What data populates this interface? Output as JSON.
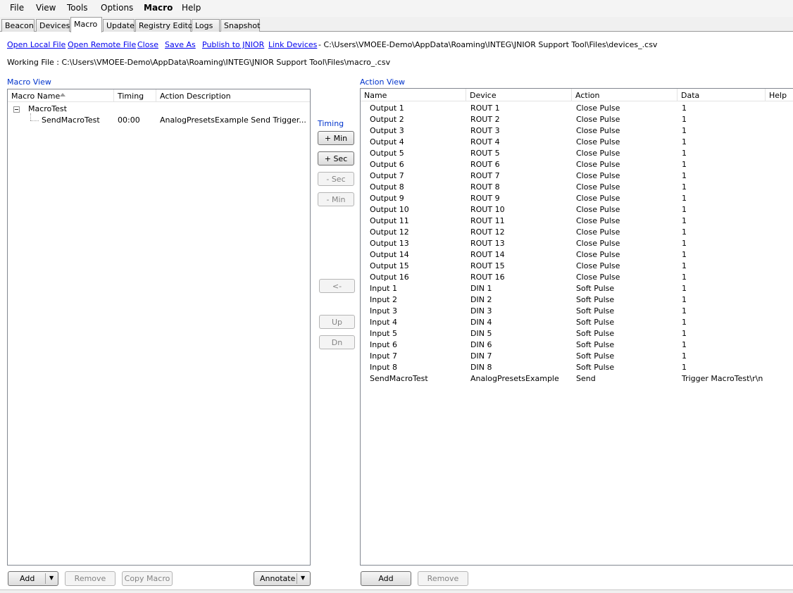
{
  "menu": {
    "file": "File",
    "view": "View",
    "tools": "Tools",
    "options": "Options",
    "macro": "Macro",
    "help": "Help"
  },
  "tabs": {
    "beacon": "Beacon",
    "devices": "Devices",
    "macro": "Macro",
    "update": "Update",
    "registry_editor": "Registry Editor",
    "logs": "Logs",
    "snapshot": "Snapshot"
  },
  "file_links": {
    "open_local": "Open Local File",
    "open_remote": "Open Remote File",
    "close": "Close",
    "save_as": "Save As",
    "publish": "Publish to JNIOR",
    "link_devices": "Link Devices"
  },
  "devices_path": "- C:\\Users\\VMOEE-Demo\\AppData\\Roaming\\INTEG\\JNIOR Support Tool\\Files\\devices_.csv",
  "working_file": "Working File : C:\\Users\\VMOEE-Demo\\AppData\\Roaming\\INTEG\\JNIOR Support Tool\\Files\\macro_.csv",
  "macro_view": {
    "title": "Macro View",
    "columns": {
      "name": "Macro Name",
      "timing": "Timing",
      "description": "Action Description"
    },
    "tree": {
      "macro": "MacroTest",
      "child": {
        "name": "SendMacroTest",
        "timing": "00:00",
        "description": "AnalogPresetsExample Send Trigger..."
      }
    }
  },
  "timing_controls": {
    "label": "Timing",
    "plus_min": "+ Min",
    "plus_sec": "+ Sec",
    "minus_sec": "- Sec",
    "minus_min": "- Min",
    "move_left": "<-",
    "up": "Up",
    "down": "Dn"
  },
  "action_view": {
    "title": "Action View",
    "columns": {
      "name": "Name",
      "device": "Device",
      "action": "Action",
      "data": "Data",
      "help": "Help"
    },
    "rows": [
      {
        "name": "Output 1",
        "device": "ROUT 1",
        "action": "Close Pulse",
        "data": "1"
      },
      {
        "name": "Output 2",
        "device": "ROUT 2",
        "action": "Close Pulse",
        "data": "1"
      },
      {
        "name": "Output 3",
        "device": "ROUT 3",
        "action": "Close Pulse",
        "data": "1"
      },
      {
        "name": "Output 4",
        "device": "ROUT 4",
        "action": "Close Pulse",
        "data": "1"
      },
      {
        "name": "Output 5",
        "device": "ROUT 5",
        "action": "Close Pulse",
        "data": "1"
      },
      {
        "name": "Output 6",
        "device": "ROUT 6",
        "action": "Close Pulse",
        "data": "1"
      },
      {
        "name": "Output 7",
        "device": "ROUT 7",
        "action": "Close Pulse",
        "data": "1"
      },
      {
        "name": "Output 8",
        "device": "ROUT 8",
        "action": "Close Pulse",
        "data": "1"
      },
      {
        "name": "Output 9",
        "device": "ROUT 9",
        "action": "Close Pulse",
        "data": "1"
      },
      {
        "name": "Output 10",
        "device": "ROUT 10",
        "action": "Close Pulse",
        "data": "1"
      },
      {
        "name": "Output 11",
        "device": "ROUT 11",
        "action": "Close Pulse",
        "data": "1"
      },
      {
        "name": "Output 12",
        "device": "ROUT 12",
        "action": "Close Pulse",
        "data": "1"
      },
      {
        "name": "Output 13",
        "device": "ROUT 13",
        "action": "Close Pulse",
        "data": "1"
      },
      {
        "name": "Output 14",
        "device": "ROUT 14",
        "action": "Close Pulse",
        "data": "1"
      },
      {
        "name": "Output 15",
        "device": "ROUT 15",
        "action": "Close Pulse",
        "data": "1"
      },
      {
        "name": "Output 16",
        "device": "ROUT 16",
        "action": "Close Pulse",
        "data": "1"
      },
      {
        "name": "Input 1",
        "device": "DIN 1",
        "action": "Soft Pulse",
        "data": "1"
      },
      {
        "name": "Input 2",
        "device": "DIN 2",
        "action": "Soft Pulse",
        "data": "1"
      },
      {
        "name": "Input 3",
        "device": "DIN 3",
        "action": "Soft Pulse",
        "data": "1"
      },
      {
        "name": "Input 4",
        "device": "DIN 4",
        "action": "Soft Pulse",
        "data": "1"
      },
      {
        "name": "Input 5",
        "device": "DIN 5",
        "action": "Soft Pulse",
        "data": "1"
      },
      {
        "name": "Input 6",
        "device": "DIN 6",
        "action": "Soft Pulse",
        "data": "1"
      },
      {
        "name": "Input 7",
        "device": "DIN 7",
        "action": "Soft Pulse",
        "data": "1"
      },
      {
        "name": "Input 8",
        "device": "DIN 8",
        "action": "Soft Pulse",
        "data": "1"
      },
      {
        "name": "SendMacroTest",
        "device": "AnalogPresetsExample",
        "action": "Send",
        "data": "Trigger MacroTest\\r\\n"
      }
    ]
  },
  "macro_buttons": {
    "add": "Add",
    "remove": "Remove",
    "copy_macro": "Copy Macro",
    "annotate": "Annotate"
  },
  "action_buttons": {
    "add": "Add",
    "remove": "Remove"
  },
  "icons": {
    "sort": "sort-ascending-icon",
    "dropdown": "dropdown-arrow-icon",
    "expander": "tree-collapse-icon"
  },
  "colors": {
    "link": "#0000ee",
    "section_title": "#0033cc",
    "panel_border": "#828790",
    "disabled_text": "#838383"
  }
}
